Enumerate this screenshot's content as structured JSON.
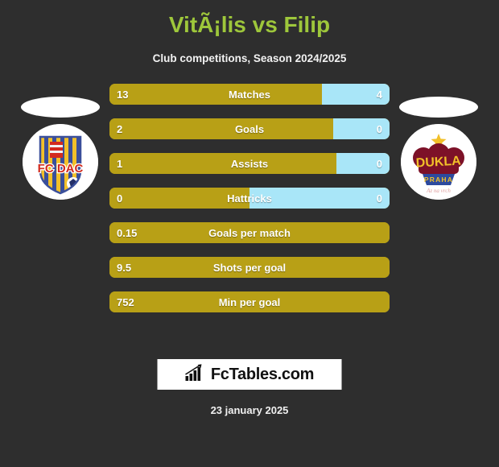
{
  "header": {
    "title": "VitÃ¡lis vs Filip",
    "subtitle": "Club competitions, Season 2024/2025"
  },
  "teams": {
    "left": {
      "name": "FC DAC",
      "crest_text": "FC DAC",
      "colors": {
        "primary": "#f2c029",
        "secondary": "#3a4f9b",
        "accent": "#d32b1e"
      }
    },
    "right": {
      "name": "Dukla Praha",
      "crest_text": "DUKLA",
      "crest_banner": "PRAHA",
      "crest_motto": "Az na vrch CT",
      "colors": {
        "primary": "#7d1128",
        "secondary": "#2d4a9e",
        "accent": "#f2c029"
      }
    }
  },
  "colors": {
    "background": "#2e2e2e",
    "title": "#9ec73b",
    "bar_left": "#b8a016",
    "bar_right": "#a9e6f8",
    "text": "#ffffff"
  },
  "chart_data": {
    "type": "bar",
    "title": "VitÃ¡lis vs Filip",
    "subtitle": "Club competitions, Season 2024/2025",
    "series": [
      {
        "name": "VitÃ¡lis",
        "color": "#b8a016"
      },
      {
        "name": "Filip",
        "color": "#a9e6f8"
      }
    ],
    "categories": [
      "Matches",
      "Goals",
      "Assists",
      "Hattricks",
      "Goals per match",
      "Shots per goal",
      "Min per goal"
    ],
    "rows": [
      {
        "label": "Matches",
        "left": "13",
        "right": "4",
        "left_pct": 76,
        "right_pct": 24,
        "split": true
      },
      {
        "label": "Goals",
        "left": "2",
        "right": "0",
        "left_pct": 80,
        "right_pct": 20,
        "split": true
      },
      {
        "label": "Assists",
        "left": "1",
        "right": "0",
        "left_pct": 81,
        "right_pct": 19,
        "split": true
      },
      {
        "label": "Hattricks",
        "left": "0",
        "right": "0",
        "left_pct": 50,
        "right_pct": 50,
        "split": true
      },
      {
        "label": "Goals per match",
        "left": "0.15",
        "right": "",
        "left_pct": 100,
        "right_pct": 0,
        "split": false
      },
      {
        "label": "Shots per goal",
        "left": "9.5",
        "right": "",
        "left_pct": 100,
        "right_pct": 0,
        "split": false
      },
      {
        "label": "Min per goal",
        "left": "752",
        "right": "",
        "left_pct": 100,
        "right_pct": 0,
        "split": false
      }
    ]
  },
  "footer": {
    "brand_text": "FcTables.com",
    "brand_icon": "bar-chart-icon",
    "date": "23 january 2025"
  }
}
